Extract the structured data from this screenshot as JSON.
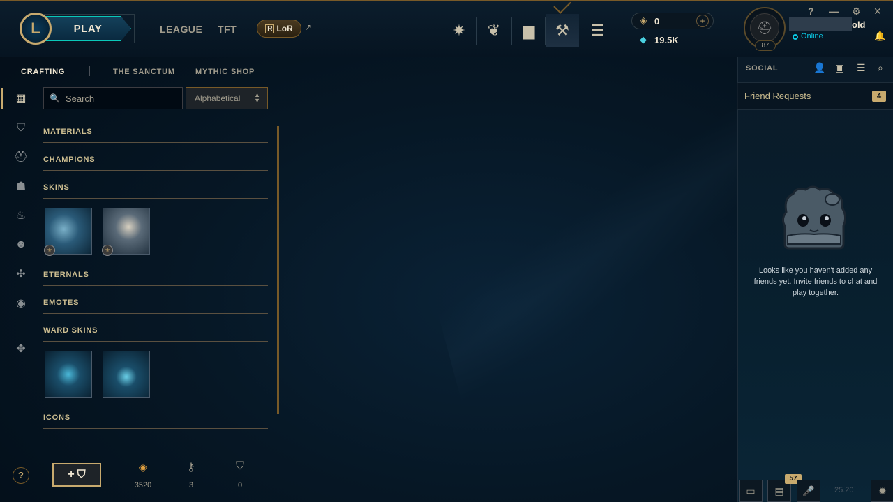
{
  "topbar": {
    "logo_letter": "L",
    "play_label": "PLAY",
    "nav": {
      "league": "LEAGUE",
      "tft": "TFT",
      "lor": "LoR",
      "lor_mark": "R"
    },
    "currency": {
      "rp": "0",
      "be": "19.5K"
    },
    "profile": {
      "level": "87",
      "name_tail": "old",
      "status": "Online"
    },
    "window_controls": {
      "help": "?",
      "minimize": "—",
      "settings": "⚙",
      "close": "✕"
    }
  },
  "crafting": {
    "tabs": {
      "crafting": "CRAFTING",
      "sanctum": "THE SANCTUM",
      "mythic": "MYTHIC SHOP"
    },
    "search": {
      "placeholder": "Search"
    },
    "sort": {
      "selected": "Alphabetical"
    },
    "sections": {
      "materials": "MATERIALS",
      "champions": "CHAMPIONS",
      "skins": "SKINS",
      "eternals": "ETERNALS",
      "emotes": "EMOTES",
      "ward_skins": "WARD SKINS",
      "icons": "ICONS"
    },
    "footer": {
      "orange_essence": "3520",
      "keys": "3",
      "chests": "0"
    }
  },
  "social": {
    "title": "SOCIAL",
    "friend_requests_label": "Friend Requests",
    "friend_requests_count": "4",
    "empty_message": "Looks like you haven't added any friends yet. Invite friends to chat and play together."
  },
  "bottom": {
    "missions_count": "57",
    "version": "25.20"
  },
  "colors": {
    "gold": "#c8aa6e",
    "teal": "#0ac8b9",
    "online": "#0acbe6"
  }
}
